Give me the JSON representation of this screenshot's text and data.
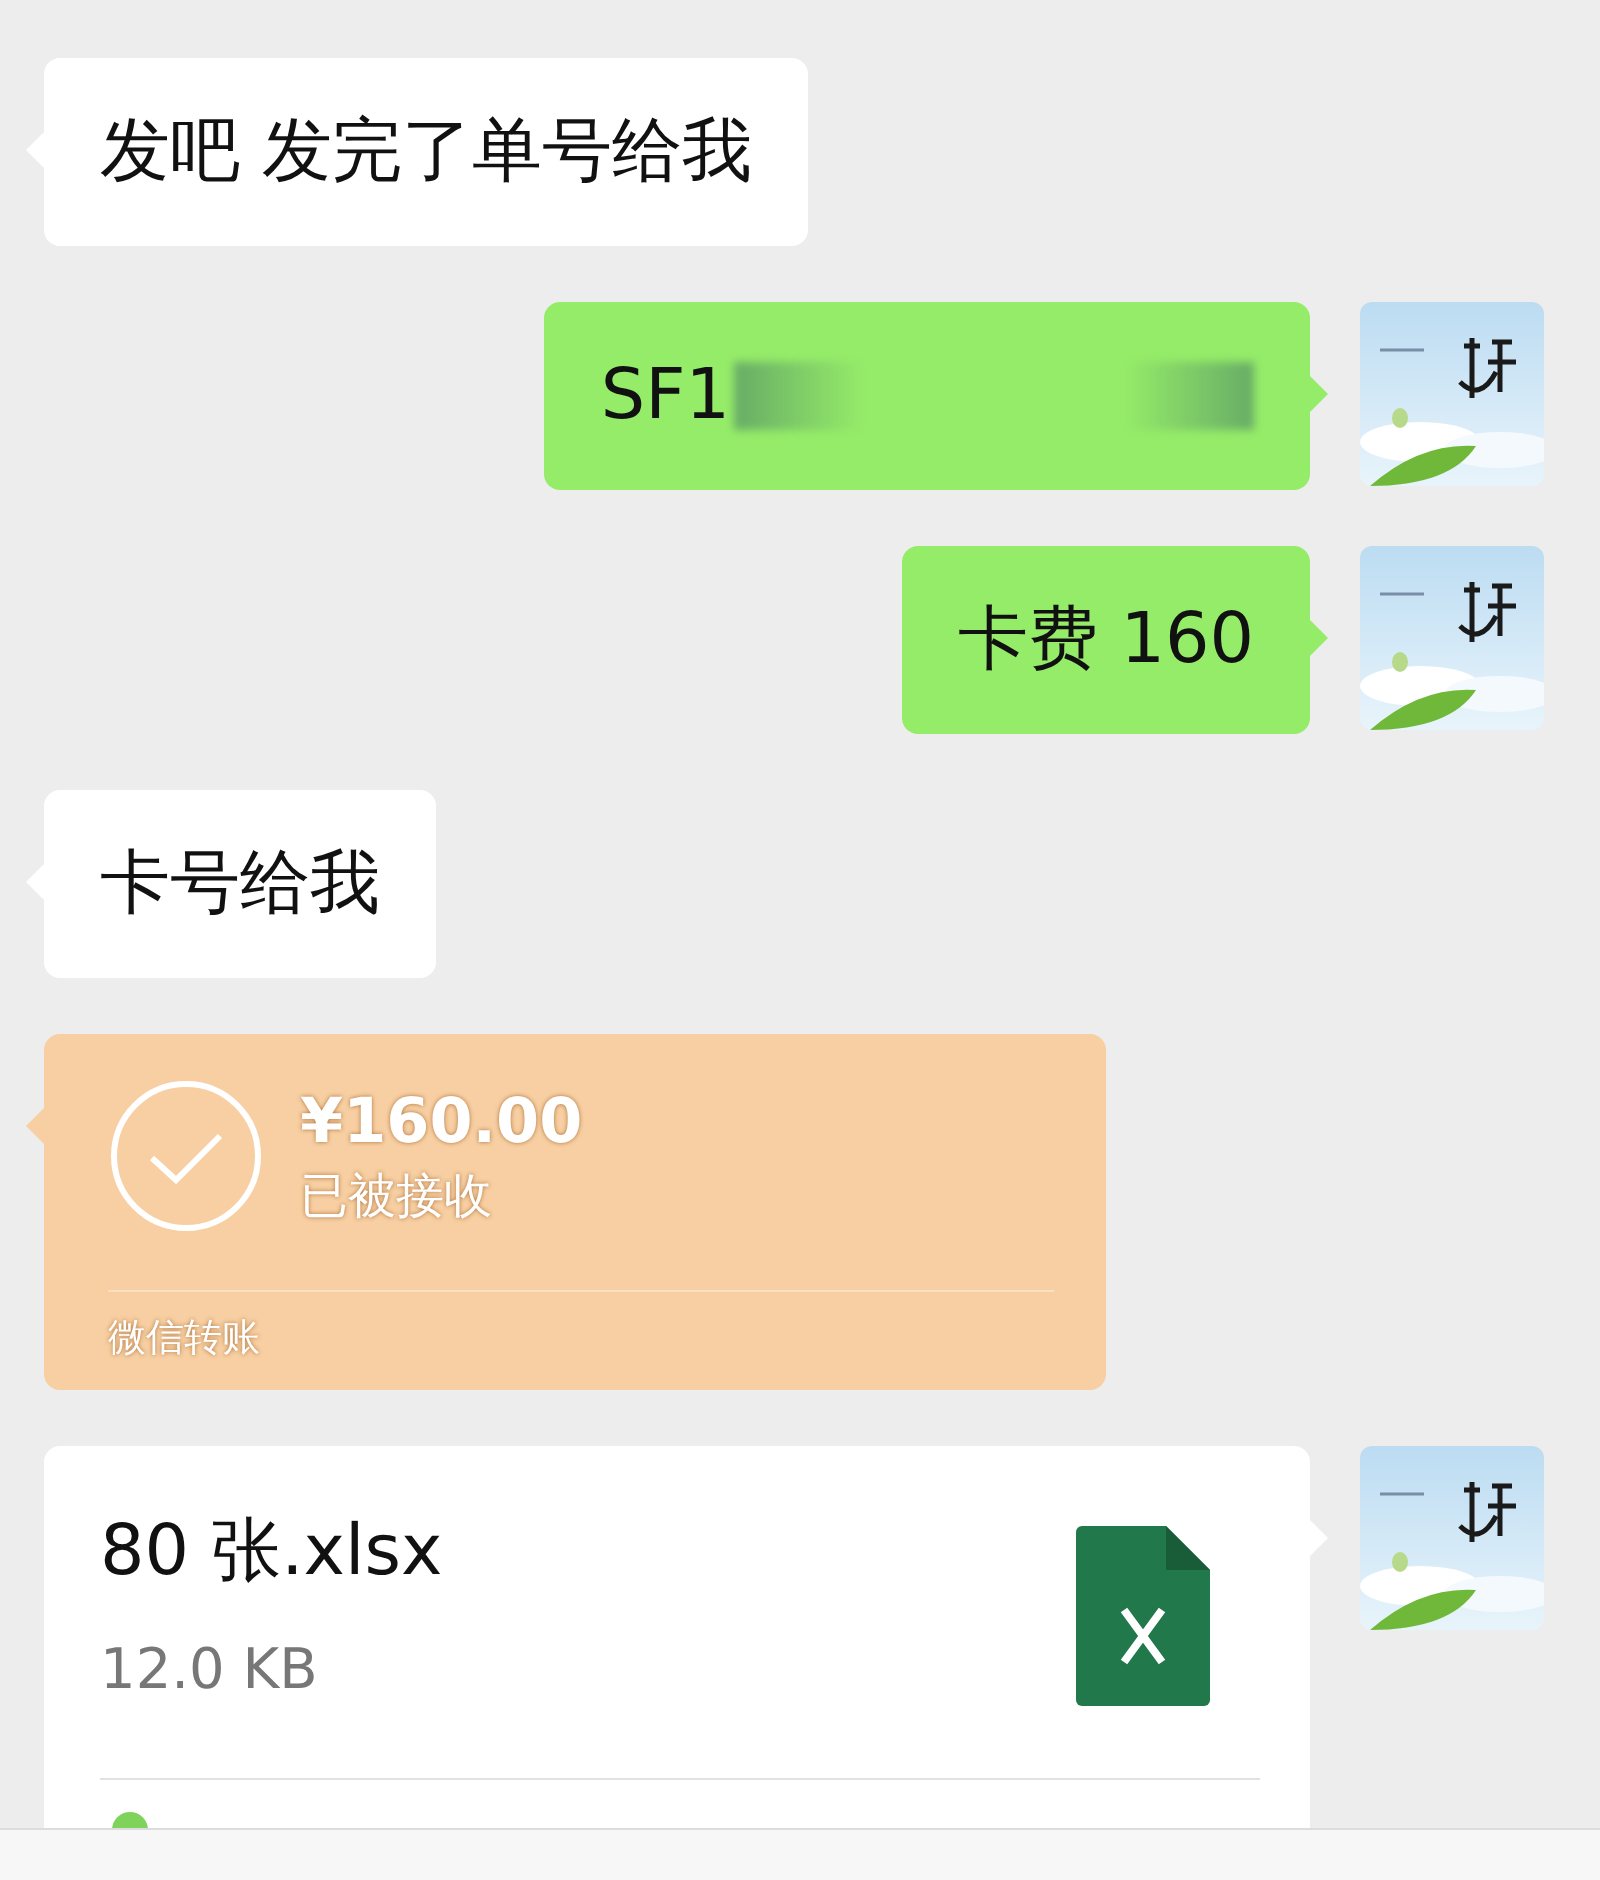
{
  "messages": [
    {
      "kind": "text",
      "outgoing": false,
      "text": "发吧 发完了单号给我"
    },
    {
      "kind": "text",
      "outgoing": true,
      "text": "SF1",
      "redacted": true
    },
    {
      "kind": "text",
      "outgoing": true,
      "text": "卡费 160"
    },
    {
      "kind": "text",
      "outgoing": false,
      "text": "卡号给我"
    },
    {
      "kind": "transfer",
      "outgoing": false,
      "amount": "¥160.00",
      "status": "已被接收",
      "label": "微信转账"
    },
    {
      "kind": "file",
      "outgoing": true,
      "name": "80 张.xlsx",
      "size": "12.0 KB"
    }
  ]
}
